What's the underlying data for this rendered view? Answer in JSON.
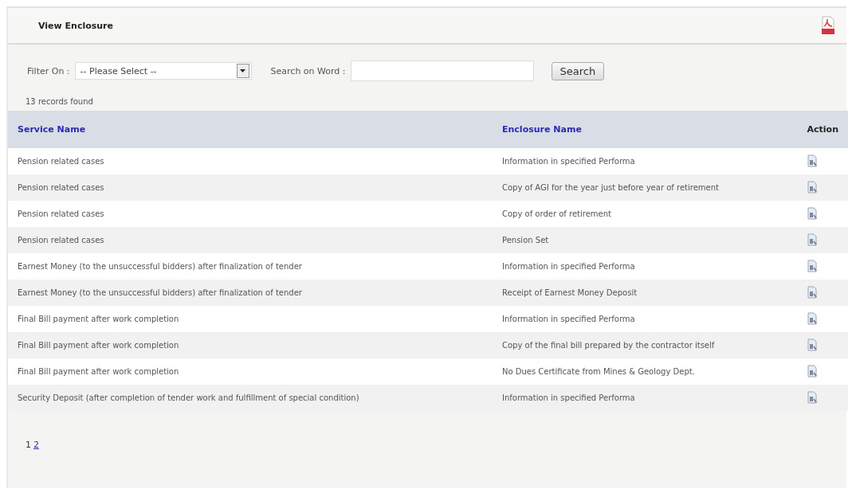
{
  "header": {
    "title": "View Enclosure"
  },
  "filter": {
    "label": "Filter On :",
    "select_value": "-- Please Select --",
    "search_label": "Search on Word :",
    "button": "Search"
  },
  "records_found": "13 records found",
  "table": {
    "columns": [
      "Service Name",
      "Enclosure Name",
      "Action"
    ],
    "rows": [
      {
        "service": "Pension related cases",
        "enclosure": "Information in specified Performa"
      },
      {
        "service": "Pension related cases",
        "enclosure": "Copy of AGI for the year just before year of retirement"
      },
      {
        "service": "Pension related cases",
        "enclosure": "Copy of order of retirement"
      },
      {
        "service": "Pension related cases",
        "enclosure": "Pension Set"
      },
      {
        "service": "Earnest Money (to the unsuccessful bidders) after finalization of tender",
        "enclosure": "Information in specified Performa"
      },
      {
        "service": "Earnest Money (to the unsuccessful bidders) after finalization of tender",
        "enclosure": "Receipt of Earnest Money Deposit"
      },
      {
        "service": "Final Bill payment after work completion",
        "enclosure": "Information in specified Performa"
      },
      {
        "service": "Final Bill payment after work completion",
        "enclosure": "Copy of the final bill prepared by the contractor itself"
      },
      {
        "service": "Final Bill payment after work completion",
        "enclosure": "No Dues Certificate from Mines & Geology Dept."
      },
      {
        "service": "Security Deposit (after completion of tender work and fulfillment of special condition)",
        "enclosure": "Information in specified Performa"
      }
    ]
  },
  "pages": [
    {
      "label": "1",
      "selected": true
    },
    {
      "label": "2",
      "selected": false
    }
  ]
}
